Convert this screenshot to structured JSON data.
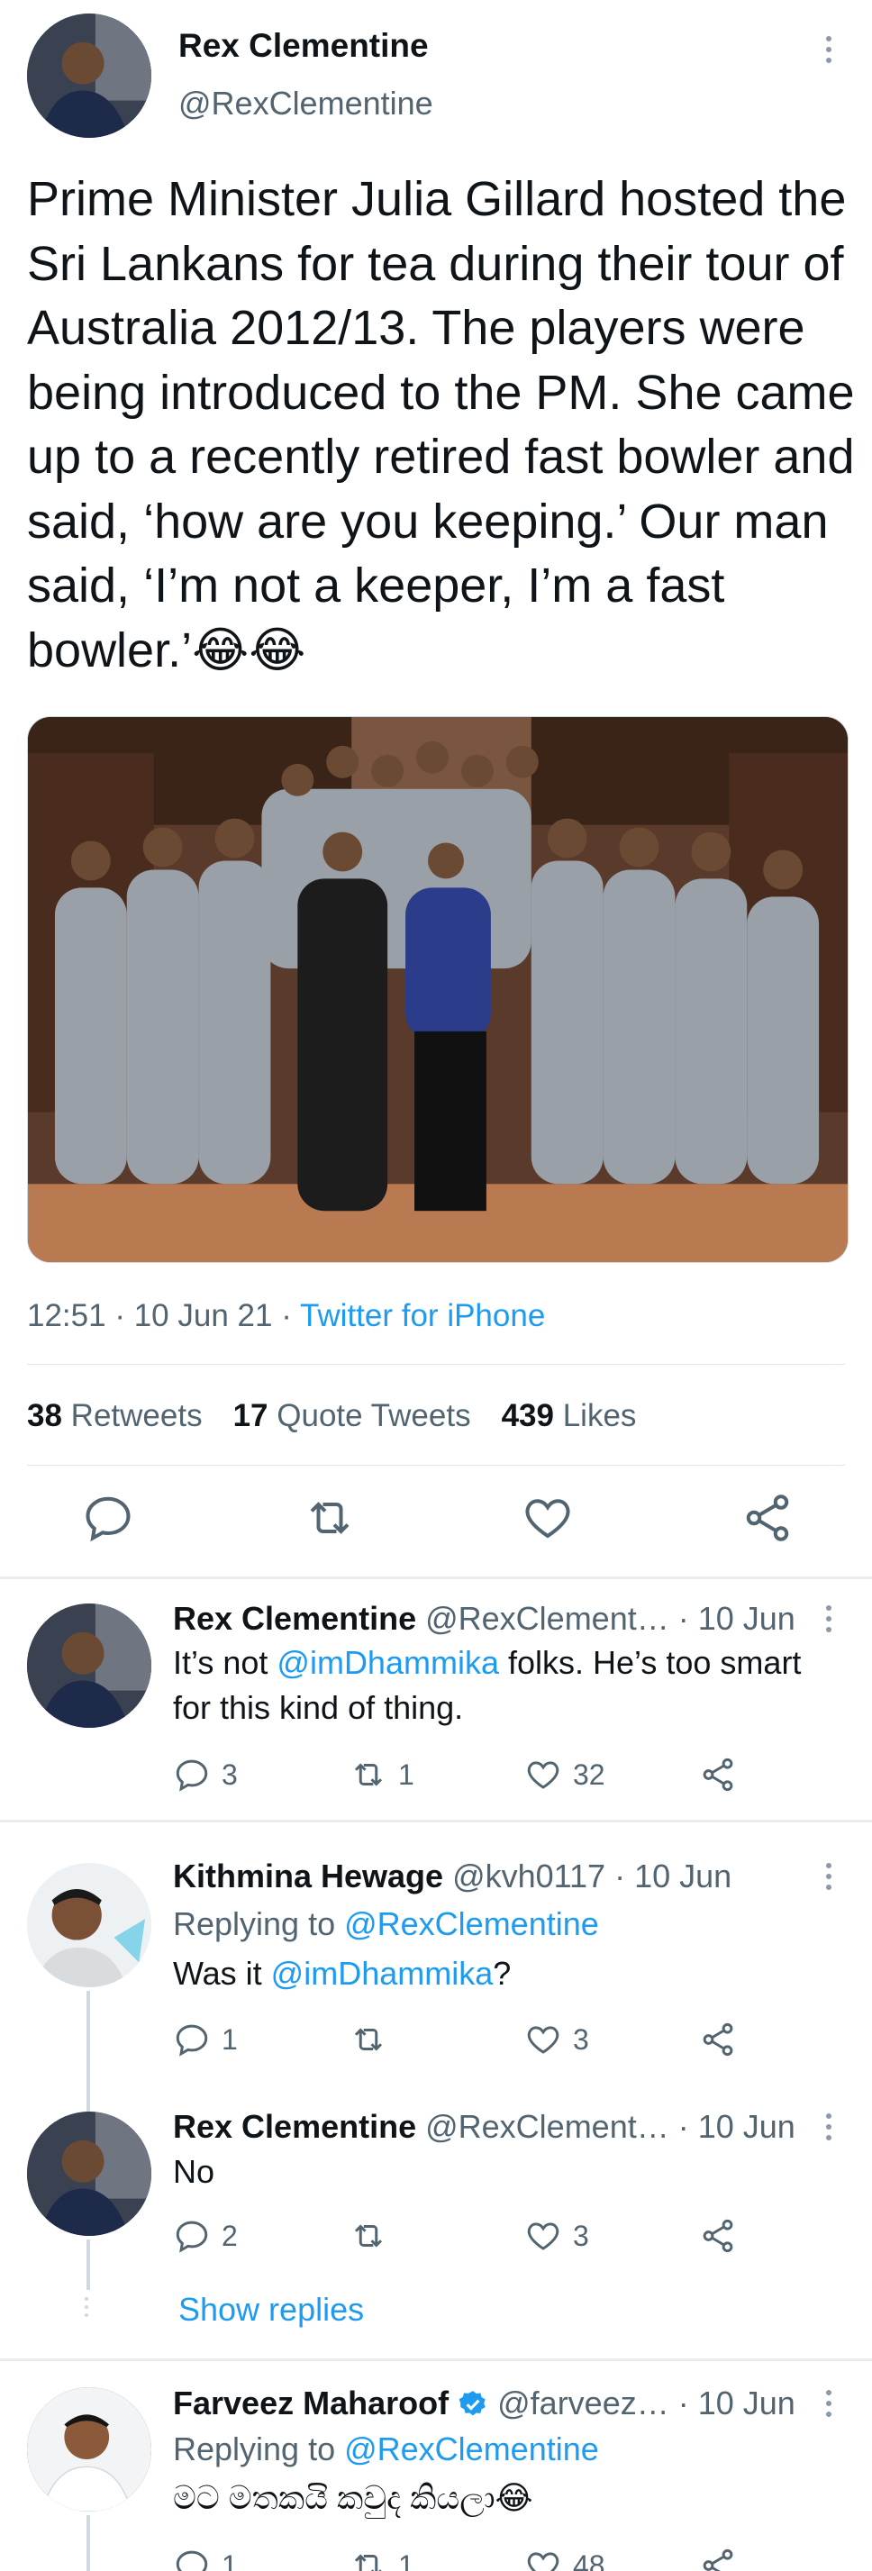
{
  "tweet": {
    "author_name": "Rex Clementine",
    "author_handle": "@RexClementine",
    "text": "Prime Minister Julia Gillard hosted the Sri Lankans for tea during their tour of Australia 2012/13. The players were being introduced to the PM. She came up to a recently retired fast bowler and said, ‘how are you keeping.’ Our man said, ‘I’m not a keeper, I’m a fast bowler.’😂😂",
    "time": "12:51",
    "date": "10 Jun 21",
    "source": "Twitter for iPhone",
    "retweets_count": "38",
    "retweets_label": "Retweets",
    "quotes_count": "17",
    "quotes_label": "Quote Tweets",
    "likes_count": "439",
    "likes_label": "Likes",
    "photo_alt": "Group photo of Sri Lankan cricket team in grey suits with the Prime Minister"
  },
  "replies": [
    {
      "name": "Rex Clementine",
      "handle": "@RexClement…",
      "date": "· 10 Jun",
      "text_before": "It’s not ",
      "mention": "@imDhammika",
      "text_after": " folks. He’s too smart for this kind of thing.",
      "reply_count": "3",
      "retweet_count": "1",
      "like_count": "32"
    },
    {
      "name": "Kithmina Hewage",
      "handle": "@kvh0117",
      "date": "· 10 Jun",
      "replying_label": "Replying to ",
      "replying_to": "@RexClementine",
      "text_before": "Was it ",
      "mention": "@imDhammika",
      "text_after": "?",
      "reply_count": "1",
      "retweet_count": "",
      "like_count": "3"
    },
    {
      "name": "Rex Clementine",
      "handle": "@RexClement…",
      "date": "· 10 Jun",
      "text": "No",
      "reply_count": "2",
      "retweet_count": "",
      "like_count": "3",
      "show_replies": "Show replies"
    },
    {
      "name": "Farveez Maharoof",
      "handle": "@farveez…",
      "date": "· 10 Jun",
      "replying_label": "Replying to ",
      "replying_to": "@RexClementine",
      "text": "මට මතකයි කවුද කියලා😂",
      "reply_count": "1",
      "retweet_count": "1",
      "like_count": "48"
    }
  ],
  "colors": {
    "link": "#1d9bf0",
    "secondary_text": "#536471",
    "divider": "#e1e8ed"
  }
}
